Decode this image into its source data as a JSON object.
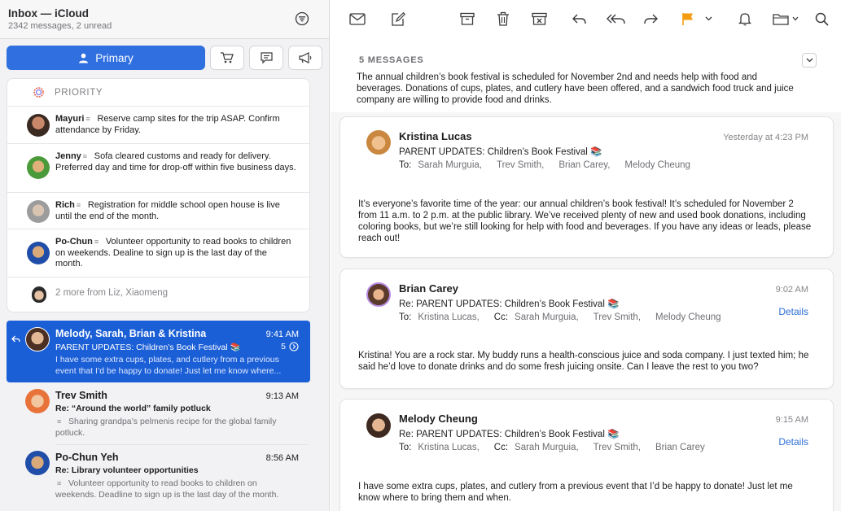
{
  "mailbox": {
    "title": "Inbox — iCloud",
    "subtitle": "2342 messages, 2 unread"
  },
  "categories": {
    "primary_label": "Primary",
    "icons": [
      "person-icon",
      "cart-icon",
      "chat-icon",
      "megaphone-icon"
    ]
  },
  "priority": {
    "header": "PRIORITY",
    "items": [
      {
        "from": "Mayuri",
        "text": "Reserve camp sites for the trip ASAP. Confirm attendance by Friday."
      },
      {
        "from": "Jenny",
        "text": "Sofa cleared customs and ready for delivery. Preferred day and time for drop-off within five business days."
      },
      {
        "from": "Rich",
        "text": "Registration for middle school open house is live until the end of the month."
      },
      {
        "from": "Po-Chun",
        "text": "Volunteer opportunity to read books to children on weekends. Dealine to sign up is the last day of the month."
      }
    ],
    "more": "2 more from Liz, Xiaomeng"
  },
  "messages": [
    {
      "from": "Melody, Sarah, Brian & Kristina",
      "time": "9:41 AM",
      "subject": "PARENT UPDATES: Children’s Book Festival 📚",
      "count": "5",
      "preview": "I have some extra cups, plates, and cutlery from a previous event that I’d be happy to donate! Just let me know where..."
    },
    {
      "from": "Trev Smith",
      "time": "9:13 AM",
      "subject": "Re: “Around the world” family potluck",
      "preview": "Sharing grandpa’s pelmenis recipe for the global family potluck."
    },
    {
      "from": "Po-Chun Yeh",
      "time": "8:56 AM",
      "subject": "Re: Library volunteer opportunities",
      "preview": "Volunteer opportunity to read books to children on weekends. Deadline to sign up is the last day of the month."
    }
  ],
  "toolbar": {
    "icons": [
      "envelope-icon",
      "compose-icon",
      "archive-icon",
      "trash-icon",
      "junk-icon",
      "reply-icon",
      "reply-all-icon",
      "forward-icon",
      "flag-icon",
      "chevron-down-icon",
      "bell-icon",
      "folder-icon",
      "search-icon"
    ],
    "flag_color": "#f39c12"
  },
  "thread": {
    "count_label": "5 MESSAGES",
    "summary": "The annual children’s book festival is scheduled for November 2nd and needs help with food and beverages. Donations of cups, plates, and cutlery have been offered, and a sandwich food truck and juice company are willing to provide food and drinks.",
    "cards": [
      {
        "name": "Kristina Lucas",
        "time": "Yesterday at 4:23 PM",
        "subject": "PARENT UPDATES: Children’s Book Festival 📚",
        "to_label": "To:",
        "to": [
          "Sarah Murguia,",
          "Trev Smith,",
          "Brian Carey,",
          "Melody Cheung"
        ],
        "body": "It’s everyone’s favorite time of the year: our annual children’s book festival! It’s scheduled for November 2 from 11 a.m. to 2 p.m. at the public library. We’ve received plenty of new and used book donations, including coloring books, but we’re still looking for help with food and beverages. If you have any ideas or leads, please reach out!"
      },
      {
        "name": "Brian Carey",
        "time": "9:02 AM",
        "subject": "Re: PARENT UPDATES: Children’s Book Festival 📚",
        "to_label": "To:",
        "to": [
          "Kristina Lucas,"
        ],
        "cc_label": "Cc:",
        "cc": [
          "Sarah Murguia,",
          "Trev Smith,",
          "Melody Cheung"
        ],
        "details": "Details",
        "body": "Kristina! You are a rock star. My buddy runs a health-conscious juice and soda company. I just texted him; he said he’d love to donate drinks and do some fresh juicing onsite. Can I leave the rest to you two?"
      },
      {
        "name": "Melody Cheung",
        "time": "9:15 AM",
        "subject": "Re: PARENT UPDATES: Children’s Book Festival 📚",
        "to_label": "To:",
        "to": [
          "Kristina Lucas,"
        ],
        "cc_label": "Cc:",
        "cc": [
          "Sarah Murguia,",
          "Trev Smith,",
          "Brian Carey"
        ],
        "details": "Details",
        "body": "I have some extra cups, plates, and cutlery from a previous event that I’d be happy to donate! Just let me know where to bring them and when."
      }
    ]
  },
  "colors": {
    "accent": "#2f6fe0",
    "selected_row": "#1b5fd6",
    "link": "#2d6fd6"
  }
}
